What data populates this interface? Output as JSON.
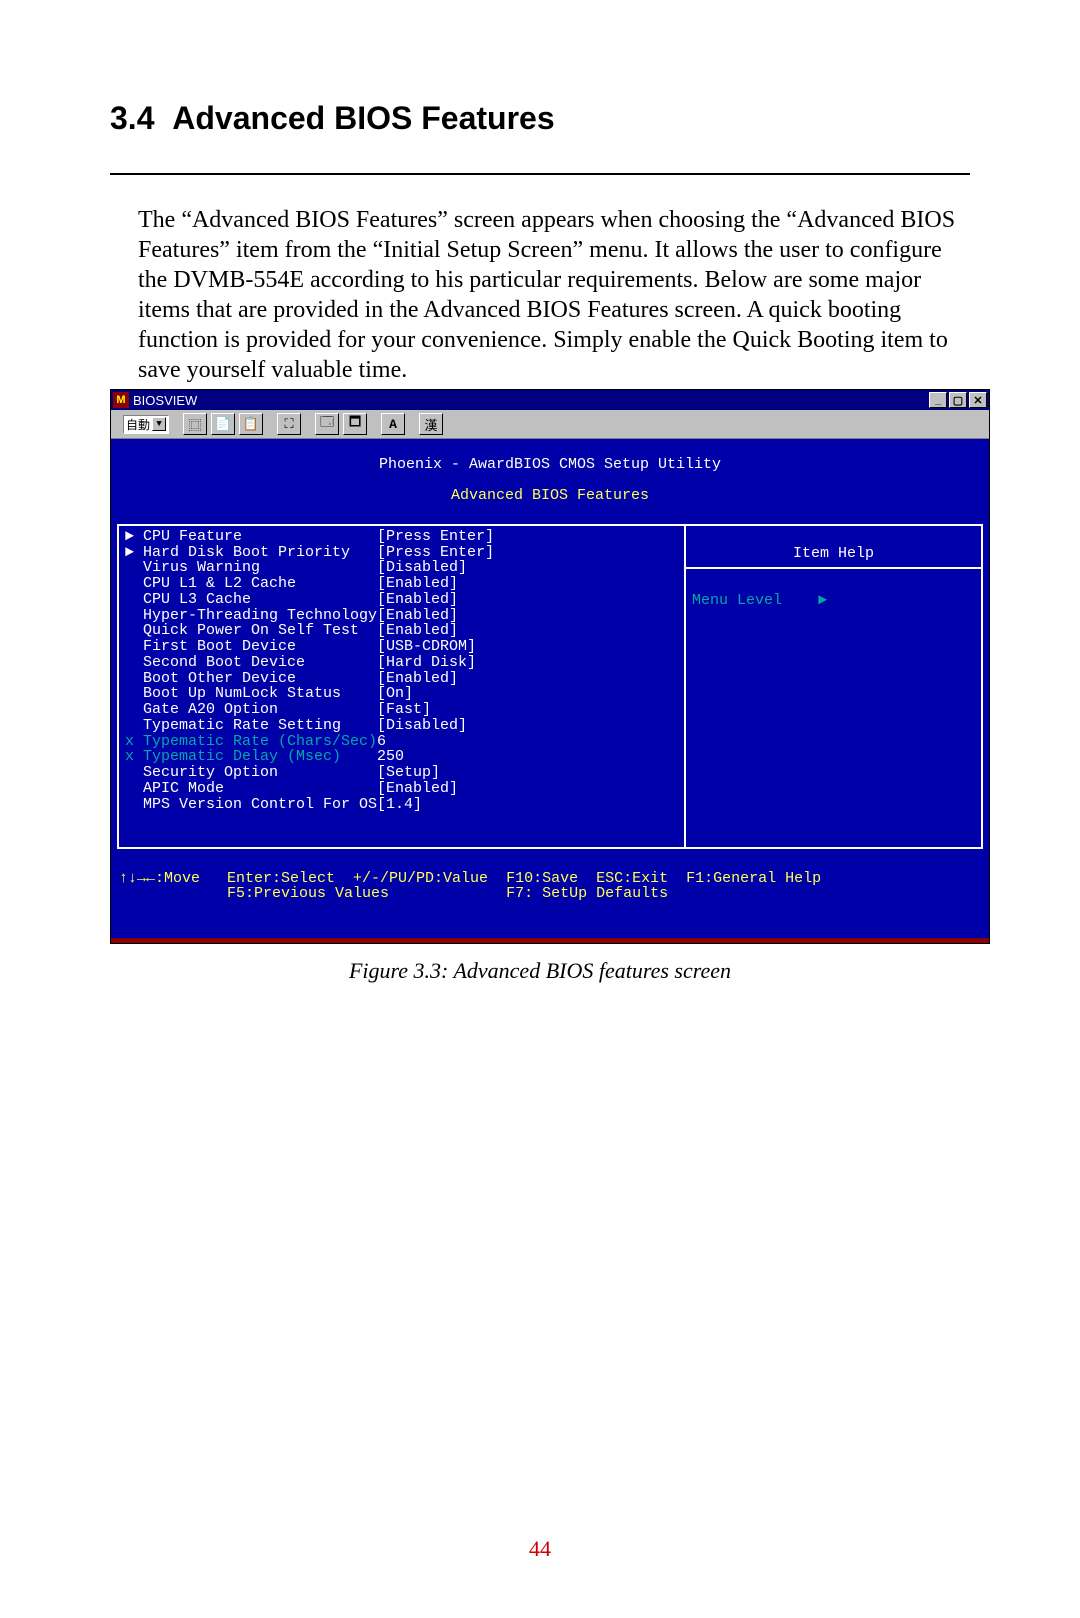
{
  "section": {
    "number": "3.4",
    "title": "Advanced BIOS Features"
  },
  "paragraph": "The “Advanced BIOS Features” screen appears when choosing the “Advanced BIOS Features” item from the “Initial Setup Screen” menu. It allows the user to configure the DVMB-554E according to his particular requirements. Below are some major items that are provided in the Advanced BIOS Features screen. A quick booting function is provided for your convenience. Simply enable the Quick Booting item to save yourself valuable time.",
  "window": {
    "app_title": "BIOSVIEW",
    "toolbar": {
      "select_label": "自動",
      "btn_font": "A",
      "btn_han": "漢"
    },
    "bios": {
      "title": "Phoenix - AwardBIOS CMOS Setup Utility",
      "subtitle": "Advanced BIOS Features",
      "help_title": "Item Help",
      "menu_level": "Menu Level    ►",
      "rows": [
        {
          "marker": "►",
          "label": "CPU Feature",
          "value": "[Press Enter]",
          "dim": false
        },
        {
          "marker": "►",
          "label": "Hard Disk Boot Priority",
          "value": "[Press Enter]",
          "dim": false
        },
        {
          "marker": " ",
          "label": "Virus Warning",
          "value": "[Disabled]",
          "dim": false
        },
        {
          "marker": " ",
          "label": "CPU L1 & L2 Cache",
          "value": "[Enabled]",
          "dim": false
        },
        {
          "marker": " ",
          "label": "CPU L3 Cache",
          "value": "[Enabled]",
          "dim": false
        },
        {
          "marker": " ",
          "label": "Hyper-Threading Technology",
          "value": "[Enabled]",
          "dim": false
        },
        {
          "marker": " ",
          "label": "Quick Power On Self Test",
          "value": "[Enabled]",
          "dim": false
        },
        {
          "marker": " ",
          "label": "First Boot Device",
          "value": "[USB-CDROM]",
          "dim": false
        },
        {
          "marker": " ",
          "label": "Second Boot Device",
          "value": "[Hard Disk]",
          "dim": false
        },
        {
          "marker": " ",
          "label": "Boot Other Device",
          "value": "[Enabled]",
          "dim": false
        },
        {
          "marker": " ",
          "label": "Boot Up NumLock Status",
          "value": "[On]",
          "dim": false
        },
        {
          "marker": " ",
          "label": "Gate A20 Option",
          "value": "[Fast]",
          "dim": false
        },
        {
          "marker": " ",
          "label": "Typematic Rate Setting",
          "value": "[Disabled]",
          "dim": false
        },
        {
          "marker": "x",
          "label": "Typematic Rate (Chars/Sec)",
          "value": "6",
          "dim": true
        },
        {
          "marker": "x",
          "label": "Typematic Delay (Msec)",
          "value": "250",
          "dim": true
        },
        {
          "marker": " ",
          "label": "Security Option",
          "value": "[Setup]",
          "dim": false
        },
        {
          "marker": " ",
          "label": "APIC Mode",
          "value": "[Enabled]",
          "dim": false
        },
        {
          "marker": " ",
          "label": "MPS Version Control For OS",
          "value": "[1.4]",
          "dim": false
        }
      ],
      "footer_line1": "↑↓→←:Move   Enter:Select  +/-/PU/PD:Value  F10:Save  ESC:Exit  F1:General Help",
      "footer_line2": "            F5:Previous Values             F7: SetUp Defaults"
    }
  },
  "figure_caption": "Figure 3.3: Advanced BIOS features screen",
  "page_number": "44"
}
